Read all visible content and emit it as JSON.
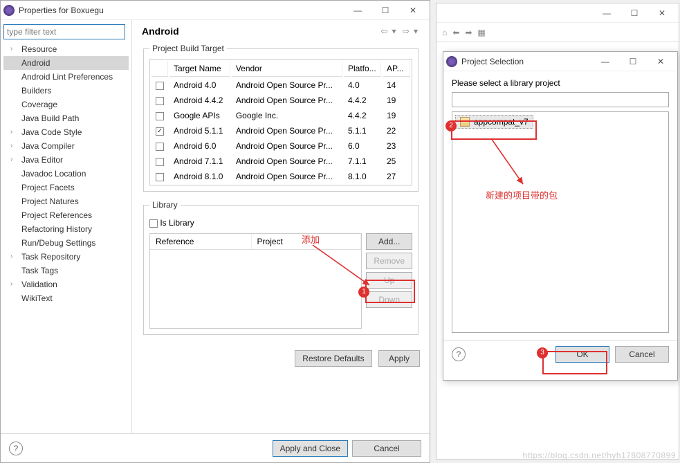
{
  "props": {
    "title": "Properties for Boxuegu",
    "filter_placeholder": "type filter text",
    "header": "Android",
    "tree": [
      {
        "label": "Resource",
        "exp": true
      },
      {
        "label": "Android",
        "sel": true
      },
      {
        "label": "Android Lint Preferences"
      },
      {
        "label": "Builders"
      },
      {
        "label": "Coverage"
      },
      {
        "label": "Java Build Path"
      },
      {
        "label": "Java Code Style",
        "exp": true
      },
      {
        "label": "Java Compiler",
        "exp": true
      },
      {
        "label": "Java Editor",
        "exp": true
      },
      {
        "label": "Javadoc Location"
      },
      {
        "label": "Project Facets"
      },
      {
        "label": "Project Natures"
      },
      {
        "label": "Project References"
      },
      {
        "label": "Refactoring History"
      },
      {
        "label": "Run/Debug Settings"
      },
      {
        "label": "Task Repository",
        "exp": true
      },
      {
        "label": "Task Tags"
      },
      {
        "label": "Validation",
        "exp": true
      },
      {
        "label": "WikiText"
      }
    ],
    "targets_group": "Project Build Target",
    "target_cols": {
      "c1": "Target Name",
      "c2": "Vendor",
      "c3": "Platfo...",
      "c4": "AP..."
    },
    "targets": [
      {
        "chk": false,
        "name": "Android 4.0",
        "vendor": "Android Open Source Pr...",
        "plat": "4.0",
        "api": "14"
      },
      {
        "chk": false,
        "name": "Android 4.4.2",
        "vendor": "Android Open Source Pr...",
        "plat": "4.4.2",
        "api": "19"
      },
      {
        "chk": false,
        "name": "Google APIs",
        "vendor": "Google Inc.",
        "plat": "4.4.2",
        "api": "19"
      },
      {
        "chk": true,
        "name": "Android 5.1.1",
        "vendor": "Android Open Source Pr...",
        "plat": "5.1.1",
        "api": "22"
      },
      {
        "chk": false,
        "name": "Android 6.0",
        "vendor": "Android Open Source Pr...",
        "plat": "6.0",
        "api": "23"
      },
      {
        "chk": false,
        "name": "Android 7.1.1",
        "vendor": "Android Open Source Pr...",
        "plat": "7.1.1",
        "api": "25"
      },
      {
        "chk": false,
        "name": "Android 8.1.0",
        "vendor": "Android Open Source Pr...",
        "plat": "8.1.0",
        "api": "27"
      }
    ],
    "library_group": "Library",
    "is_library_label": "Is Library",
    "ref_cols": {
      "c1": "Reference",
      "c2": "Project"
    },
    "buttons": {
      "add": "Add...",
      "remove": "Remove",
      "up": "Up",
      "down": "Down",
      "restore": "Restore Defaults",
      "apply": "Apply",
      "apply_close": "Apply and Close",
      "cancel": "Cancel"
    }
  },
  "ps": {
    "title": "Project Selection",
    "msg": "Please select a library project",
    "item": "appcompat_v7",
    "ok": "OK",
    "cancel": "Cancel"
  },
  "ann": {
    "add_label": "添加",
    "pkg_label": "新建的项目带的包",
    "watermark": "https://blog.csdn.net/hyh17808770899"
  }
}
